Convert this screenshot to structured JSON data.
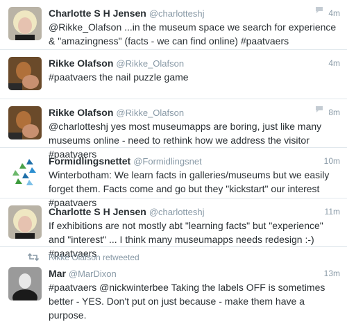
{
  "tweets": [
    {
      "fullname": "Charlotte S H Jensen",
      "screen_name": "@charlotteshj",
      "time": "4m",
      "replies": "",
      "text": "@Rikke_Olafson ...in the museum space we search for experience & \"amazingness\" (facts - we can find online) #paatvaers"
    },
    {
      "fullname": "Rikke Olafson",
      "screen_name": "@Rikke_Olafson",
      "time": "4m",
      "text": "#paatvaers the nail puzzle game"
    },
    {
      "fullname": "Rikke Olafson",
      "screen_name": "@Rikke_Olafson",
      "time": "8m",
      "replies": "",
      "text": "@charlotteshj yes most museumapps are boring, just like many museums online - need to rethink how we address the visitor #paatvaers"
    },
    {
      "fullname": "Formidlingsnettet",
      "screen_name": "@Formidlingsnet",
      "time": "10m",
      "text": "Winterbotham: We learn facts in galleries/museums but we easily forget them. Facts come and go but they \"kickstart\" our interest #paatvaers"
    },
    {
      "fullname": "Charlotte S H Jensen",
      "screen_name": "@charlotteshj",
      "time": "11m",
      "text": "If exhibitions are not mostly abt \"learning facts\" but \"experience\" and \"interest\" ... I think many museumapps needs redesign :-) #paatvaers"
    },
    {
      "retweeted_by": "Rikke Olafson retweeted",
      "fullname": "Mar",
      "screen_name": "@MarDixon",
      "time": "13m",
      "text": "#paatvaers @nickwinterbee Taking the labels OFF is sometimes better - YES.  Don't put on just because - make them have a purpose."
    }
  ],
  "icons": {
    "reply": "speech-bubble-icon",
    "retweet": "retweet-icon"
  },
  "colors": {
    "name": "#292f33",
    "muted": "#8899a6",
    "divider": "#e1e8ed"
  }
}
